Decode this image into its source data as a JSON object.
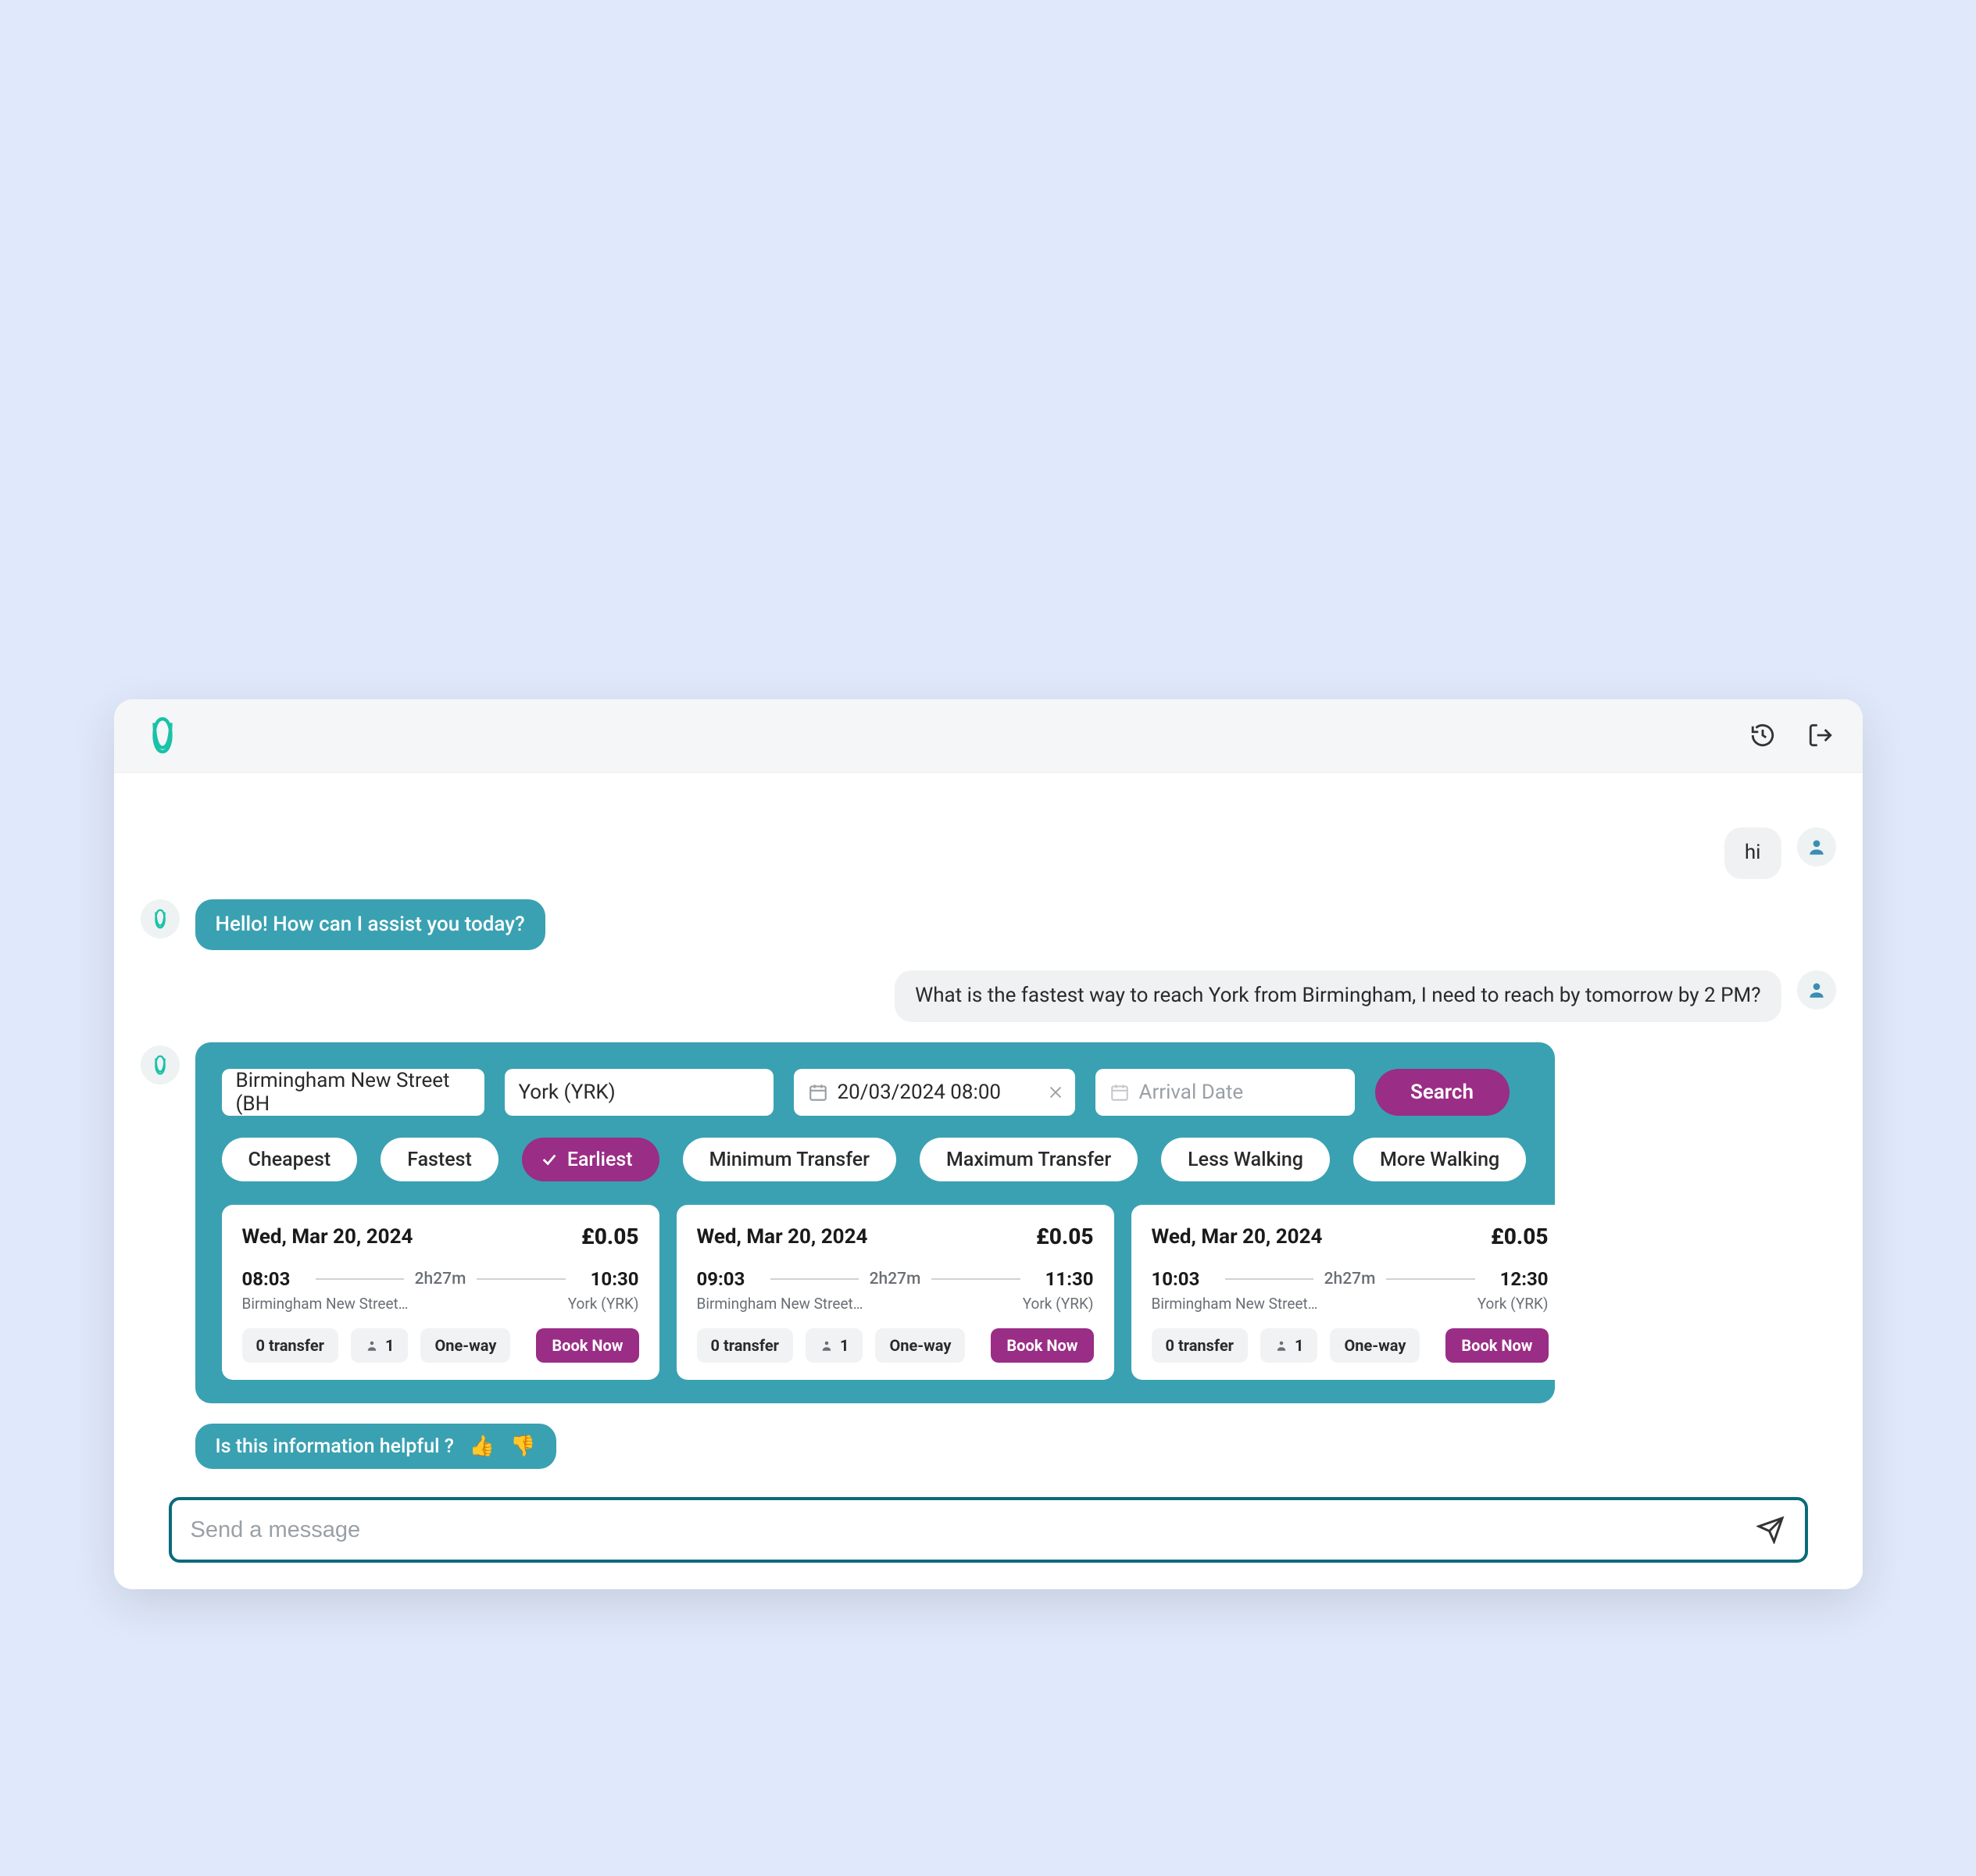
{
  "topbar": {
    "history_icon": "history",
    "logout_icon": "logout"
  },
  "messages": {
    "user_hi": "hi",
    "bot_greeting": "Hello! How can I assist you today?",
    "user_query": "What is the fastest way to reach York from Birmingham, I need to reach by tomorrow by 2 PM?"
  },
  "search": {
    "from": "Birmingham New Street (BH",
    "to": "York (YRK)",
    "departure_date": "20/03/2024 08:00",
    "arrival_placeholder": "Arrival Date",
    "search_label": "Search"
  },
  "filters": [
    {
      "label": "Cheapest",
      "active": false
    },
    {
      "label": "Fastest",
      "active": false
    },
    {
      "label": "Earliest",
      "active": true
    },
    {
      "label": "Minimum Transfer",
      "active": false
    },
    {
      "label": "Maximum Transfer",
      "active": false
    },
    {
      "label": "Less Walking",
      "active": false
    },
    {
      "label": "More Walking",
      "active": false
    }
  ],
  "results": [
    {
      "date": "Wed, Mar 20, 2024",
      "price": "£0.05",
      "dep_time": "08:03",
      "duration": "2h27m",
      "arr_time": "10:30",
      "from_station": "Birmingham New Street…",
      "to_station": "York (YRK)",
      "transfers": "0 transfer",
      "pax": "1",
      "trip_type": "One-way",
      "book_label": "Book Now"
    },
    {
      "date": "Wed, Mar 20, 2024",
      "price": "£0.05",
      "dep_time": "09:03",
      "duration": "2h27m",
      "arr_time": "11:30",
      "from_station": "Birmingham New Street…",
      "to_station": "York (YRK)",
      "transfers": "0 transfer",
      "pax": "1",
      "trip_type": "One-way",
      "book_label": "Book Now"
    },
    {
      "date": "Wed, Mar 20, 2024",
      "price": "£0.05",
      "dep_time": "10:03",
      "duration": "2h27m",
      "arr_time": "12:30",
      "from_station": "Birmingham New Street…",
      "to_station": "York (YRK)",
      "transfers": "0 transfer",
      "pax": "1",
      "trip_type": "One-way",
      "book_label": "Book Now"
    }
  ],
  "feedback": {
    "prompt": "Is this information helpful ?"
  },
  "composer": {
    "placeholder": "Send a message"
  },
  "colors": {
    "teal": "#3aa1b2",
    "magenta": "#9a2d85",
    "bg": "#e0e9fb"
  }
}
